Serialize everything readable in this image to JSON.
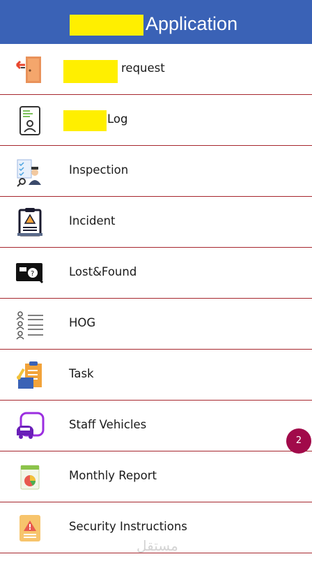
{
  "header": {
    "title": "Application"
  },
  "menu": [
    {
      "label": "request",
      "icon": "door-exit-icon",
      "redacted_prefix": true
    },
    {
      "label": "Log",
      "icon": "id-card-icon",
      "redacted_prefix": true
    },
    {
      "label": "Inspection",
      "icon": "inspector-checklist-icon"
    },
    {
      "label": "Incident",
      "icon": "incident-report-icon"
    },
    {
      "label": "Lost&Found",
      "icon": "lost-found-icon"
    },
    {
      "label": "HOG",
      "icon": "people-list-icon"
    },
    {
      "label": "Task",
      "icon": "task-clipboard-icon"
    },
    {
      "label": "Staff Vehicles",
      "icon": "vehicle-icon"
    },
    {
      "label": "Monthly Report",
      "icon": "monthly-report-icon"
    },
    {
      "label": "Security Instructions",
      "icon": "security-instructions-icon"
    }
  ],
  "badge": {
    "count": "2"
  },
  "watermark": "مستقل",
  "colors": {
    "header_bg": "#3a62b6",
    "redaction": "#ffef00",
    "divider": "#a6262d",
    "badge": "#a10a4a"
  }
}
